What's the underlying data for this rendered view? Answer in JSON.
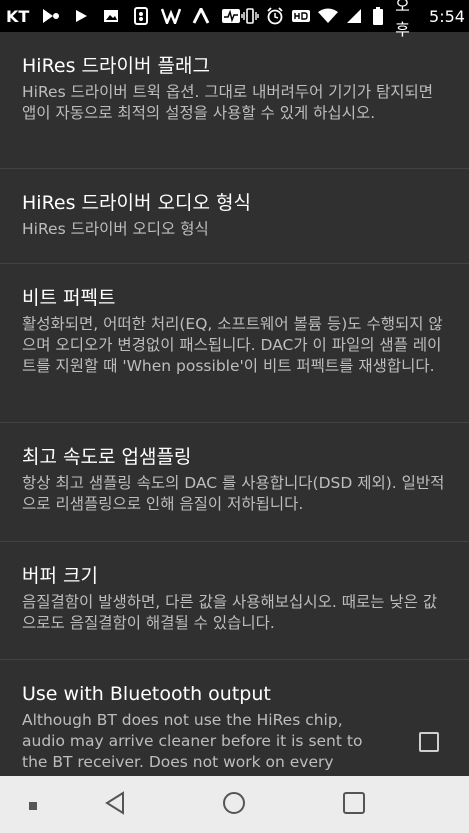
{
  "status_bar": {
    "carrier": "KT",
    "ampm": "오후",
    "time": "5:54",
    "left_icons": [
      "play-logo-icon",
      "play-icon",
      "image-icon",
      "ticket-icon",
      "v-logo-icon",
      "lambda-logo-icon",
      "pulse-icon"
    ],
    "right_icons": [
      "vibrate-icon",
      "alarm-icon",
      "hd-icon",
      "wifi-icon",
      "signal-icon",
      "battery-icon"
    ]
  },
  "preferences": [
    {
      "title": "HiRes 드라이버 플래그",
      "summary": "HiRes 드라이버 트윅 옵션. 그대로 내버려두어 기기가 탐지되면 앱이 자동으로 최적의 설정을 사용할 수 있게 하십시오."
    },
    {
      "title": "HiRes 드라이버 오디오 형식",
      "summary": "HiRes 드라이버 오디오 형식"
    },
    {
      "title": "비트 퍼펙트",
      "summary": "활성화되면, 어떠한 처리(EQ, 소프트웨어 볼륨 등)도 수행되지 않으며 오디오가 변경없이 패스됩니다. DAC가 이 파일의 샘플 레이트를 지원할 때 'When possible'이 비트 퍼펙트를 재생합니다."
    },
    {
      "title": "최고 속도로 업샘플링",
      "summary": "항상 최고 샘플링 속도의 DAC 를 사용합니다(DSD 제외). 일반적으로 리샘플링으로 인해 음질이 저하됩니다."
    },
    {
      "title": "버퍼 크기",
      "summary": "음질결함이 발생하면, 다른 값을 사용해보십시오. 때로는 낮은 값으로도 음질결함이 해결될 수 있습니다."
    },
    {
      "title": "Use with Bluetooth output",
      "summary": "Although BT does not use the HiRes chip, audio may arrive cleaner before it is sent to the BT receiver. Does not work on every",
      "checked": false
    }
  ],
  "nav_bar": {
    "icons": [
      "recents-dot-icon",
      "back-icon",
      "home-icon",
      "overview-icon"
    ]
  },
  "colors": {
    "background": "#303030",
    "status_bar": "#000000",
    "divider": "#434343",
    "nav_bar": "#ececec",
    "summary_text": "#bdbdbd"
  }
}
